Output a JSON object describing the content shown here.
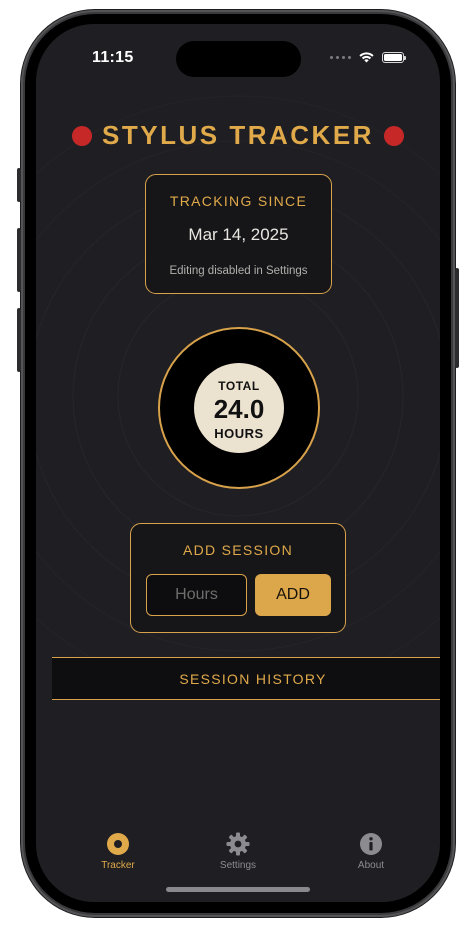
{
  "status_bar": {
    "time": "11:15",
    "icons": [
      "cellular-signal-icon",
      "wifi-icon",
      "battery-icon"
    ]
  },
  "header": {
    "title": "STYLUS TRACKER",
    "dot_color": "#c62828"
  },
  "tracking_since": {
    "heading": "TRACKING SINCE",
    "date": "Mar 14, 2025",
    "note": "Editing disabled in Settings"
  },
  "total": {
    "top_label": "TOTAL",
    "value": "24.0",
    "bottom_label": "HOURS"
  },
  "add_session": {
    "heading": "ADD SESSION",
    "input_placeholder": "Hours",
    "input_value": "",
    "button_label": "ADD"
  },
  "session_history": {
    "heading": "SESSION HISTORY"
  },
  "tabs": [
    {
      "label": "Tracker",
      "icon": "record-icon",
      "active": true
    },
    {
      "label": "Settings",
      "icon": "gear-icon",
      "active": false
    },
    {
      "label": "About",
      "icon": "info-icon",
      "active": false
    }
  ],
  "colors": {
    "accent": "#e0a94a",
    "background": "#1f1f23",
    "record_label": "#ece2d0"
  }
}
